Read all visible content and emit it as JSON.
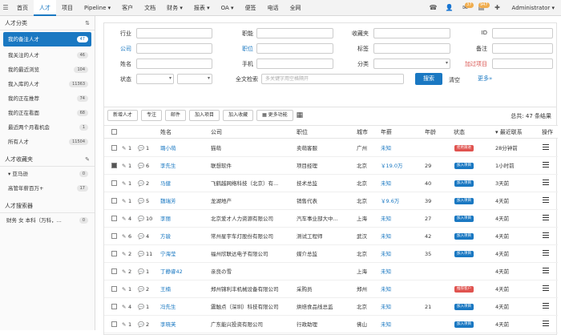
{
  "topbar": {
    "nav": [
      "首页",
      "人才",
      "项目",
      "Pipeline ▾",
      "客户",
      "文档",
      "财务 ▾",
      "报表 ▾",
      "OA ▾",
      "便签",
      "电话",
      "全网"
    ],
    "active_index": 1,
    "badge_mail": "37",
    "badge_task": "947",
    "user": "Administrator ▾"
  },
  "sidebar": {
    "section1_title": "人才分类",
    "items": [
      {
        "label": "我的备注人才",
        "count": "47",
        "active": true
      },
      {
        "label": "我关注的人才",
        "count": "46"
      },
      {
        "label": "我的最近浏览",
        "count": "104"
      },
      {
        "label": "我入库的人才",
        "count": "11363"
      },
      {
        "label": "我的正在推荐",
        "count": "74"
      },
      {
        "label": "我的正在看面",
        "count": "68"
      },
      {
        "label": "最近两个月看机会",
        "count": "1"
      },
      {
        "label": "所有人才",
        "count": "11504"
      }
    ],
    "section2_title": "人才收藏夹",
    "fav_items": [
      {
        "label": "▾ 亚马逊",
        "count": "0"
      },
      {
        "label": "高管年薪百万+",
        "count": "17"
      }
    ],
    "section3_title": "人才搜索器",
    "search_select": "财务 女 本科（万科，...",
    "search_count": "0"
  },
  "filter": {
    "labels": {
      "industry": "行业",
      "company": "公司",
      "name": "姓名",
      "status": "状态",
      "function": "职能",
      "position": "职位",
      "phone": "手机",
      "fulltext": "全文检索",
      "fav": "收藏夹",
      "tag": "标签",
      "category": "分类",
      "id": "ID",
      "remark": "备注",
      "add_project": "加过项目"
    },
    "fulltext_placeholder": "多关键字用空格隔开",
    "search_btn": "搜索",
    "clear_btn": "清空",
    "more": "更多»"
  },
  "toolbar": {
    "buttons": [
      "新增人才",
      "专注",
      "邮件",
      "加入项目",
      "加入收藏",
      "▦ 更多功能"
    ],
    "total": "总共: 47 条结果"
  },
  "table": {
    "headers": [
      "姓名",
      "公司",
      "职位",
      "城市",
      "年薪",
      "年龄",
      "状态",
      "▾ 最近联系",
      "操作"
    ],
    "rows": [
      {
        "att": "1",
        "cmt": "1",
        "name": "璐小萌",
        "company": "猫萌",
        "position": "卖萌客服",
        "city": "广州",
        "salary": "未知",
        "age": "",
        "status": "拒绝跟进",
        "status_color": "#e0534f",
        "last": "28分钟前",
        "checked": false
      },
      {
        "att": "1",
        "cmt": "6",
        "name": "李先生",
        "company": "联想软件",
        "position": "项目经理",
        "city": "北京",
        "salary": "￥19.0万",
        "age": "29",
        "status": "加入项目",
        "status_color": "#1a78c2",
        "last": "1小时前",
        "checked": true
      },
      {
        "att": "1",
        "cmt": "2",
        "name": "马健",
        "company": "飞鹤越网络科技（北京）有...",
        "position": "技术总监",
        "city": "北京",
        "salary": "未知",
        "age": "40",
        "status": "加入项目",
        "status_color": "#1a78c2",
        "last": "3天前",
        "checked": false
      },
      {
        "att": "1",
        "cmt": "5",
        "name": "魏瑞芳",
        "company": "龙湖地产",
        "position": "销售代表",
        "city": "北京",
        "salary": "￥9.6万",
        "age": "39",
        "status": "加入项目",
        "status_color": "#1a78c2",
        "last": "4天前",
        "checked": false
      },
      {
        "att": "4",
        "cmt": "10",
        "name": "李丽",
        "company": "北京爱才人力资源有限公司",
        "position": "汽车事业部大中...",
        "city": "上海",
        "salary": "未知",
        "age": "27",
        "status": "加入项目",
        "status_color": "#1a78c2",
        "last": "4天前",
        "checked": false
      },
      {
        "att": "6",
        "cmt": "4",
        "name": "方骏",
        "company": "常州星宇车灯股份有限公司",
        "position": "测试工程师",
        "city": "武汉",
        "salary": "未知",
        "age": "42",
        "status": "加入项目",
        "status_color": "#1a78c2",
        "last": "4天前",
        "checked": false
      },
      {
        "att": "2",
        "cmt": "11",
        "name": "宁海莹",
        "company": "福州欣联达电子有限公司",
        "position": "媒介总监",
        "city": "北京",
        "salary": "未知",
        "age": "35",
        "status": "加入项目",
        "status_color": "#1a78c2",
        "last": "4天前",
        "checked": false
      },
      {
        "att": "2",
        "cmt": "1",
        "name": "丁静睿42",
        "company": "亲良の雪",
        "position": "",
        "city": "上海",
        "salary": "未知",
        "age": "",
        "status": "",
        "status_color": "",
        "last": "4天前",
        "checked": false
      },
      {
        "att": "1",
        "cmt": "2",
        "name": "王楠",
        "company": "郑州锦利丰机械设备有限公司",
        "position": "采购员",
        "city": "郑州",
        "salary": "未知",
        "age": "",
        "status": "推荐客户",
        "status_color": "#e0534f",
        "last": "4天前",
        "checked": false
      },
      {
        "att": "4",
        "cmt": "1",
        "name": "冯先生",
        "company": "震触点（深圳）科技有限公司",
        "position": "烘焙食品线总监",
        "city": "北京",
        "salary": "未知",
        "age": "21",
        "status": "加入项目",
        "status_color": "#1a78c2",
        "last": "4天前",
        "checked": false
      },
      {
        "att": "1",
        "cmt": "2",
        "name": "李晓芙",
        "company": "广东能兴投资有限公司",
        "position": "行政助理",
        "city": "佛山",
        "salary": "未知",
        "age": "",
        "status": "加入项目",
        "status_color": "#1a78c2",
        "last": "4天前",
        "checked": false
      }
    ]
  }
}
